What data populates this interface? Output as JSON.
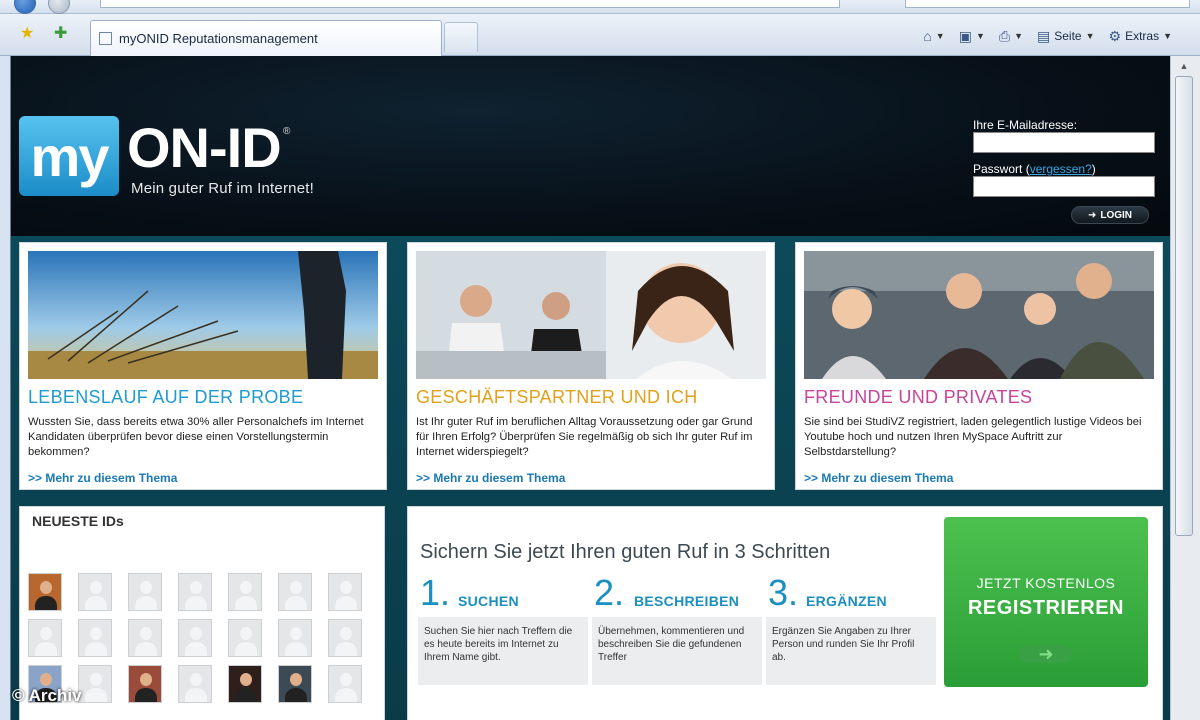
{
  "browser": {
    "tab_title": "myONID Reputationsmanagement",
    "commands": [
      {
        "icon": "home-icon",
        "label": ""
      },
      {
        "icon": "feeds-icon",
        "label": ""
      },
      {
        "icon": "print-icon",
        "label": ""
      },
      {
        "icon": "page-icon",
        "label": "Seite"
      },
      {
        "icon": "tools-icon",
        "label": "Extras"
      }
    ]
  },
  "header": {
    "logo_my": "my",
    "logo_word": "ON-ID",
    "logo_mark": "®",
    "tagline": "Mein guter Ruf im Internet!",
    "email_label": "Ihre E-Mailadresse:",
    "password_label": "Passwort",
    "forgot_link": "vergessen?",
    "login_button": "LOGIN"
  },
  "cards": [
    {
      "title": "LEBENSLAUF AUF DER PROBE",
      "title_color": "#1f9bd1",
      "text": "Wussten Sie, dass bereits etwa 30% aller Personalchefs im Internet Kandidaten überprüfen bevor diese einen Vorstellungstermin bekommen?",
      "more": ">> Mehr zu diesem Thema"
    },
    {
      "title": "GESCHÄFTSPARTNER UND ICH",
      "title_color": "#e0a21b",
      "text": "Ist Ihr guter Ruf im beruflichen Alltag Voraussetzung oder gar Grund für Ihren Erfolg? Überprüfen Sie regelmäßig ob sich Ihr guter Ruf im Internet widerspiegelt?",
      "more": ">> Mehr zu diesem Thema"
    },
    {
      "title": "FREUNDE UND PRIVATES",
      "title_color": "#c6449a",
      "text": "Sie sind bei StudiVZ registriert, laden gelegentlich lustige Videos bei Youtube hoch und nutzen Ihren MySpace Auftritt zur Selbstdarstellung?",
      "more": ">> Mehr zu diesem Thema"
    }
  ],
  "newest_ids": {
    "title": "NEUESTE IDs"
  },
  "register": {
    "title": "Sichern Sie jetzt Ihren guten Ruf in 3 Schritten",
    "steps": [
      {
        "num": "1.",
        "name": "SUCHEN",
        "text": "Suchen Sie hier nach Treffern die es heute bereits im Internet zu Ihrem Name gibt."
      },
      {
        "num": "2.",
        "name": "BESCHREIBEN",
        "text": "Übernehmen, kommentieren und beschreiben Sie die gefundenen Treffer"
      },
      {
        "num": "3.",
        "name": "ERGÄNZEN",
        "text": "Ergänzen Sie Angaben zu Ihrer Person und runden Sie Ihr Profil ab."
      }
    ],
    "cta_line1": "JETZT KOSTENLOS",
    "cta_line2": "REGISTRIEREN"
  },
  "watermark": "© Archiv",
  "colors": {
    "accent_blue": "#1b8fc0",
    "cta_green": "#2fa63a",
    "header_bg": "#071018",
    "band_bg": "#0c4a5a"
  }
}
